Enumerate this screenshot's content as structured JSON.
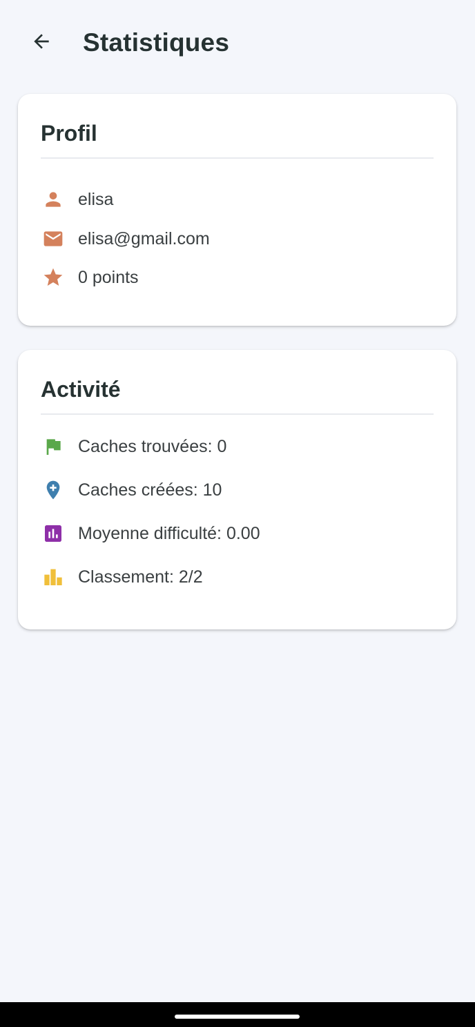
{
  "header": {
    "title": "Statistiques",
    "back_icon": "arrow-back-icon"
  },
  "profile": {
    "title": "Profil",
    "items": [
      {
        "icon": "person-icon",
        "text": "elisa",
        "color": "#d4815c"
      },
      {
        "icon": "mail-icon",
        "text": "elisa@gmail.com",
        "color": "#d4815c"
      },
      {
        "icon": "star-icon",
        "text": "0 points",
        "color": "#d4815c"
      }
    ]
  },
  "activity": {
    "title": "Activité",
    "items": [
      {
        "icon": "flag-icon",
        "text": "Caches trouvées: 0",
        "color": "#5aa84a"
      },
      {
        "icon": "add-location-icon",
        "text": "Caches créées: 10",
        "color": "#3f7fae"
      },
      {
        "icon": "bar-chart-icon",
        "text": "Moyenne difficulté: 0.00",
        "color": "#8e2fa8"
      },
      {
        "icon": "leaderboard-icon",
        "text": "Classement: 2/2",
        "color": "#f0bf3a"
      }
    ]
  },
  "colors": {
    "background": "#f4f6fb",
    "card": "#ffffff",
    "text_primary": "#263232"
  }
}
